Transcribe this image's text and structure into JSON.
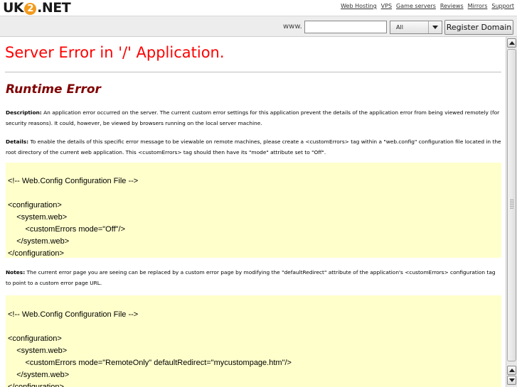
{
  "header": {
    "logo": {
      "prefix": "UK",
      "mark": "2",
      "suffix": ".NET"
    },
    "links": [
      "Web Hosting",
      "VPS",
      "Game servers",
      "Reviews",
      "Mirrors",
      "Support"
    ]
  },
  "domain_search": {
    "prefix_label": "www.",
    "input_value": "",
    "tld_selected": "All",
    "button_label": "Register Domain"
  },
  "error_page": {
    "title": "Server Error in '/' Application.",
    "subtitle": "Runtime Error",
    "description_label": "Description:",
    "description_text": " An application error occurred on the server. The current custom error settings for this application prevent the details of the application error from being viewed remotely (for security reasons). It could, however, be viewed by browsers running on the local server machine.",
    "details_label": "Details:",
    "details_text": " To enable the details of this specific error message to be viewable on remote machines, please create a <customErrors> tag within a \"web.config\" configuration file located in the root directory of the current web application. This <customErrors> tag should then have its \"mode\" attribute set to \"Off\".",
    "code1": [
      "<!-- Web.Config Configuration File -->",
      "",
      "<configuration>",
      "    <system.web>",
      "        <customErrors mode=\"Off\"/>",
      "    </system.web>",
      "</configuration>"
    ],
    "notes_label": "Notes:",
    "notes_text": " The current error page you are seeing can be replaced by a custom error page by modifying the \"defaultRedirect\" attribute of the application's <customErrors> configuration tag to point to a custom error page URL.",
    "code2": [
      "<!-- Web.Config Configuration File -->",
      "",
      "<configuration>",
      "    <system.web>",
      "        <customErrors mode=\"RemoteOnly\" defaultRedirect=\"mycustompage.htm\"/>",
      "    </system.web>",
      "</configuration>"
    ]
  },
  "colors": {
    "title_red": "#ff0000",
    "subtitle_maroon": "#800000",
    "code_background": "#ffffcc",
    "logo_orange": "#f39a1d"
  },
  "icons": {
    "scroll_up": "arrow-up-icon",
    "scroll_down": "arrow-down-icon",
    "select_dropdown": "chevron-down-icon"
  }
}
